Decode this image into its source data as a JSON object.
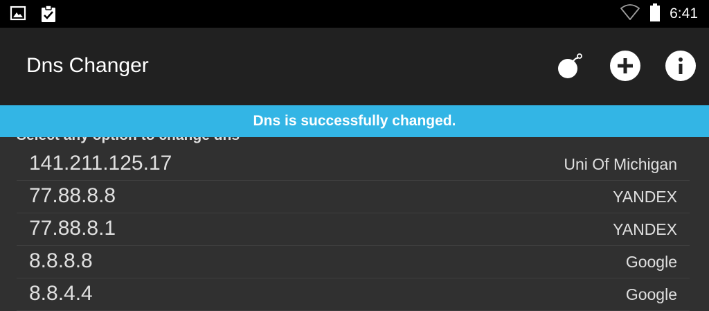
{
  "status_bar": {
    "time": "6:41",
    "left_icons": [
      "image-icon",
      "clipboard-check-icon"
    ],
    "right_icons": [
      "wifi-icon",
      "battery-icon"
    ]
  },
  "app_bar": {
    "title": "Dns Changer",
    "actions": [
      "bomb-icon",
      "add-icon",
      "info-icon"
    ]
  },
  "toast": {
    "message": "Dns is successfully changed."
  },
  "hint": "Select any option to change dns",
  "dns_list": [
    {
      "ip": "141.211.125.17",
      "provider": "Uni Of Michigan"
    },
    {
      "ip": "77.88.8.8",
      "provider": "YANDEX"
    },
    {
      "ip": "77.88.8.1",
      "provider": "YANDEX"
    },
    {
      "ip": "8.8.8.8",
      "provider": "Google"
    },
    {
      "ip": "8.8.4.4",
      "provider": "Google"
    }
  ],
  "colors": {
    "toast": "#33b5e5",
    "app_bar": "#212121",
    "background": "#303030"
  }
}
